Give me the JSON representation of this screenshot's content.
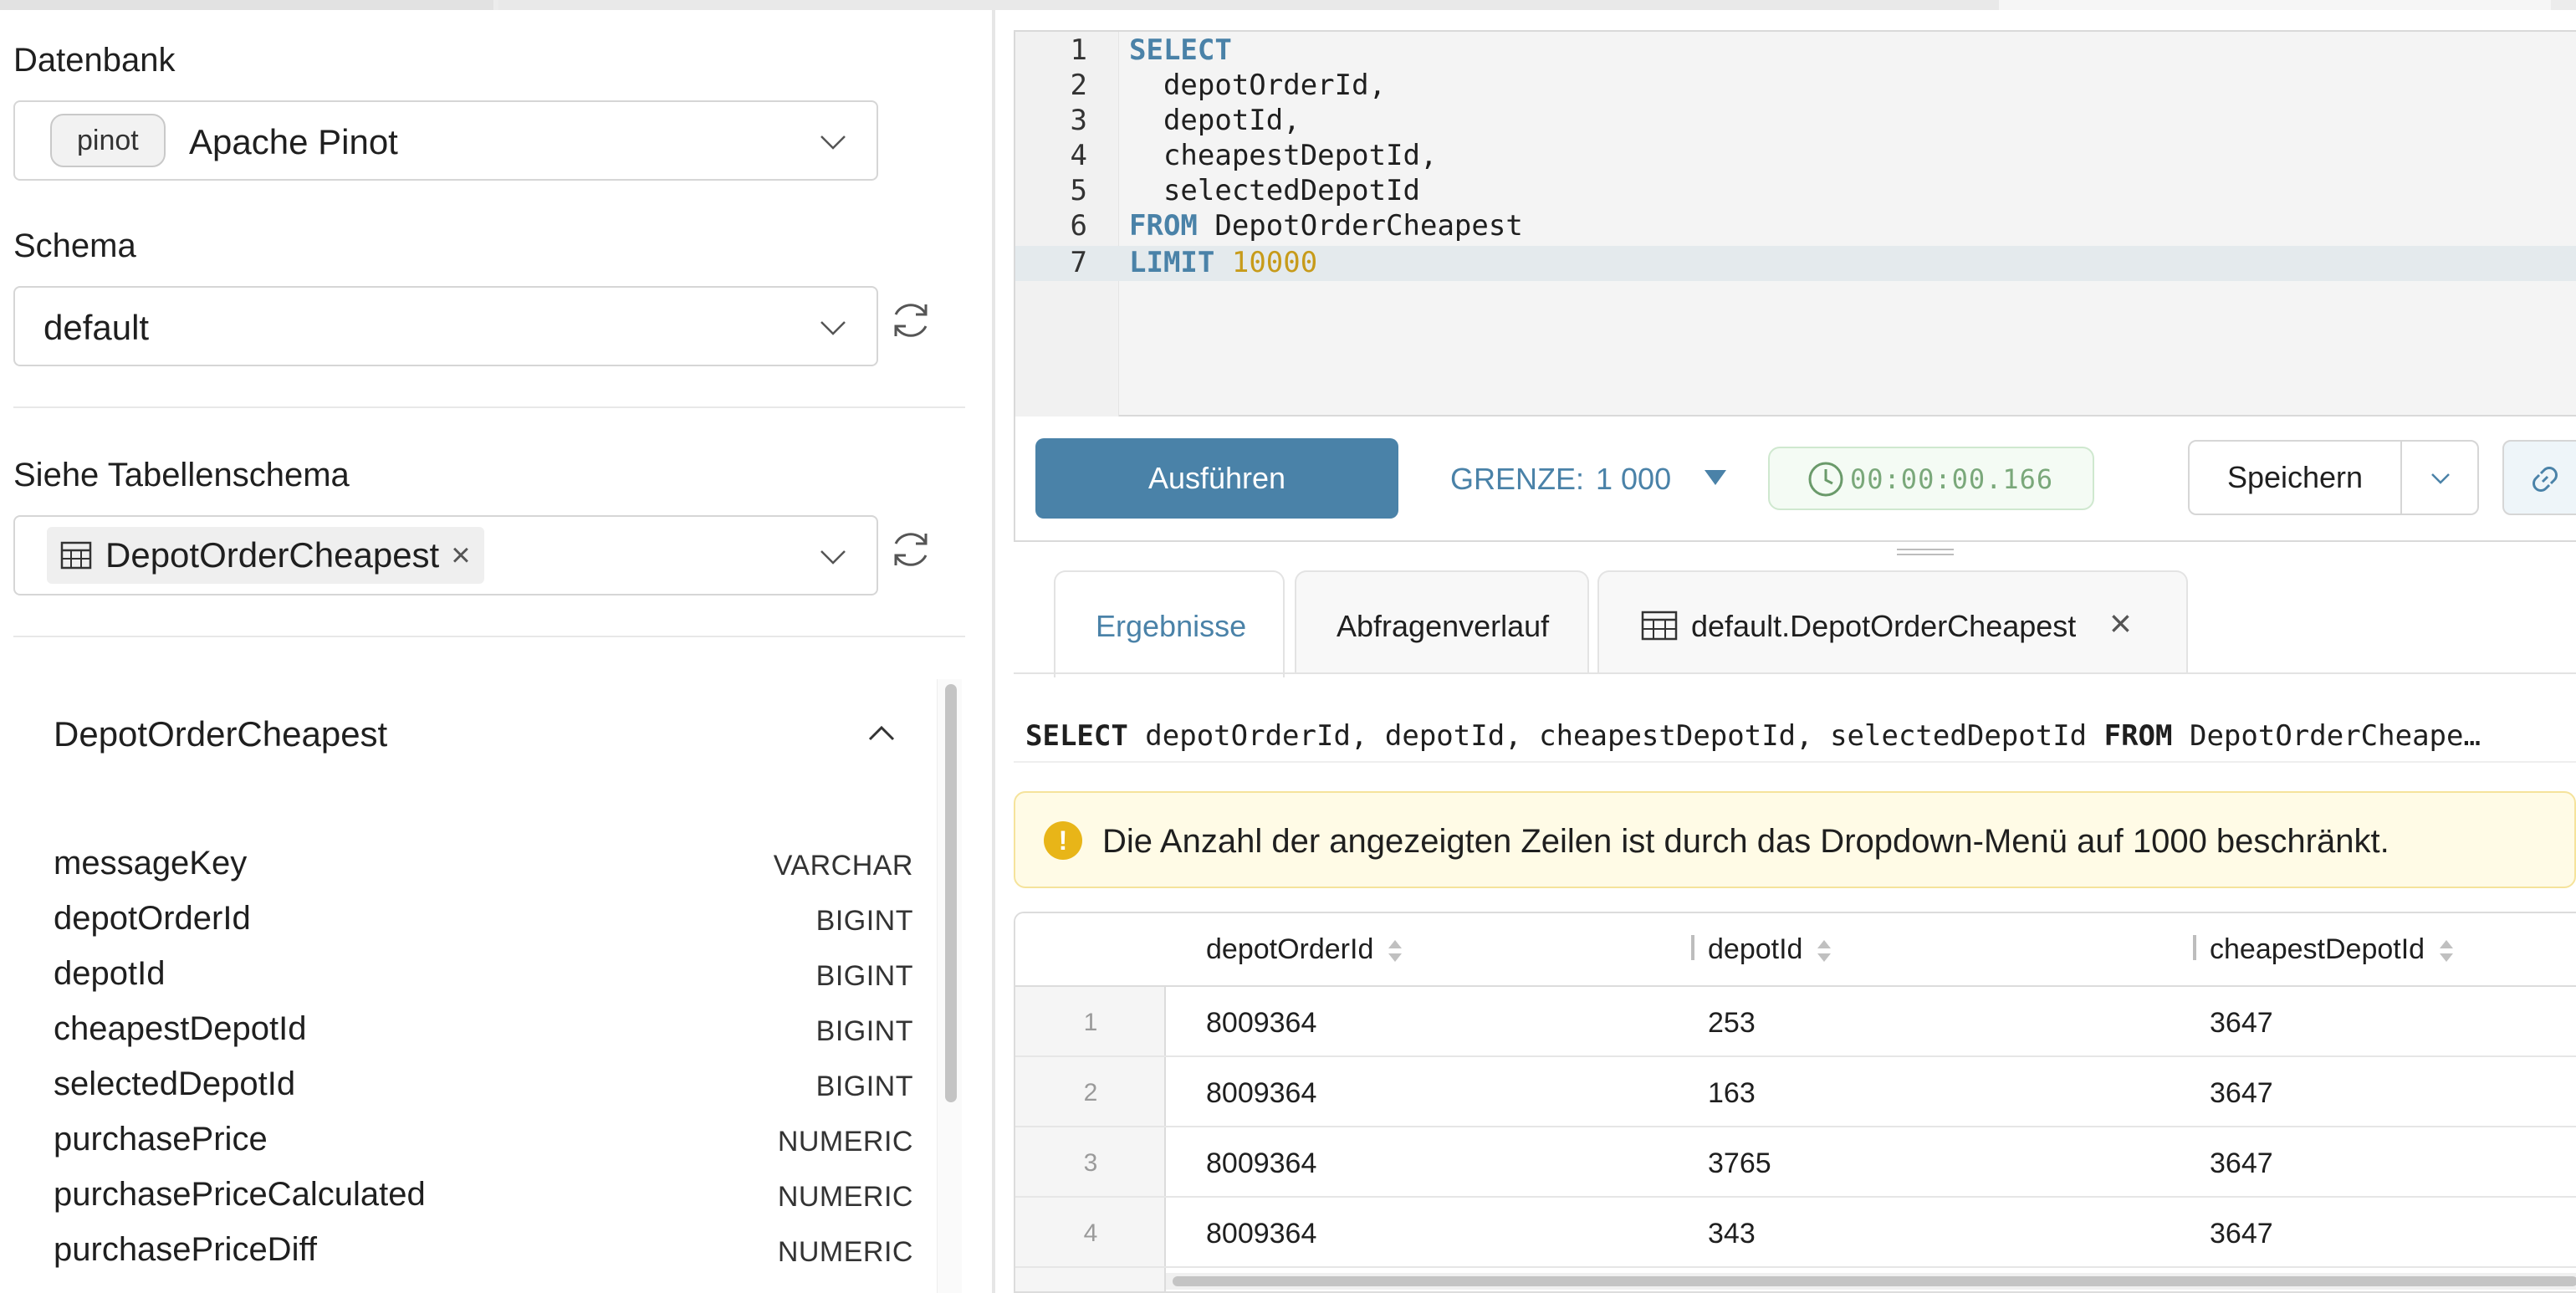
{
  "left": {
    "database": {
      "label": "Datenbank",
      "tag": "pinot",
      "value": "Apache Pinot"
    },
    "schema": {
      "label": "Schema",
      "value": "default"
    },
    "table_schema": {
      "label": "Siehe Tabellenschema",
      "chip": "DepotOrderCheapest"
    },
    "schema_card": {
      "title": "DepotOrderCheapest",
      "columns": [
        {
          "name": "messageKey",
          "type": "VARCHAR"
        },
        {
          "name": "depotOrderId",
          "type": "BIGINT"
        },
        {
          "name": "depotId",
          "type": "BIGINT"
        },
        {
          "name": "cheapestDepotId",
          "type": "BIGINT"
        },
        {
          "name": "selectedDepotId",
          "type": "BIGINT"
        },
        {
          "name": "purchasePrice",
          "type": "NUMERIC"
        },
        {
          "name": "purchasePriceCalculated",
          "type": "NUMERIC"
        },
        {
          "name": "purchasePriceDiff",
          "type": "NUMERIC"
        }
      ]
    }
  },
  "editor": {
    "line_numbers": [
      "1",
      "2",
      "3",
      "4",
      "5",
      "6",
      "7"
    ],
    "lines": [
      {
        "kw": "SELECT",
        "text": "",
        "num": ""
      },
      {
        "kw": "",
        "text": "  depotOrderId,",
        "num": ""
      },
      {
        "kw": "",
        "text": "  depotId,",
        "num": ""
      },
      {
        "kw": "",
        "text": "  cheapestDepotId,",
        "num": ""
      },
      {
        "kw": "",
        "text": "  selectedDepotId",
        "num": ""
      },
      {
        "kw": "FROM",
        "text": " DepotOrderCheapest",
        "num": ""
      },
      {
        "kw": "LIMIT",
        "text": " ",
        "num": "10000"
      }
    ]
  },
  "toolbar": {
    "run_label": "Ausführen",
    "limit_label": "GRENZE:",
    "limit_value": "1 000",
    "timer": "00:00:00.166",
    "save_label": "Speichern"
  },
  "tabs": [
    {
      "label": "Ergebnisse"
    },
    {
      "label": "Abfragenverlauf"
    },
    {
      "label": "default.DepotOrderCheapest"
    }
  ],
  "results": {
    "sql_preview": {
      "kw1": "SELECT",
      "cols": " depotOrderId, depotId, cheapestDepotId, selectedDepotId ",
      "kw2": "FROM",
      "rest": " DepotOrderCheape…"
    },
    "alert": "Die Anzahl der angezeigten Zeilen ist durch das Dropdown-Menü auf 1000 beschränkt.",
    "table": {
      "headers": [
        "depotOrderId",
        "depotId",
        "cheapestDepotId"
      ],
      "rows": [
        {
          "n": "1",
          "cells": [
            "8009364",
            "253",
            "3647"
          ]
        },
        {
          "n": "2",
          "cells": [
            "8009364",
            "163",
            "3647"
          ]
        },
        {
          "n": "3",
          "cells": [
            "8009364",
            "3765",
            "3647"
          ]
        },
        {
          "n": "4",
          "cells": [
            "8009364",
            "343",
            "3647"
          ]
        }
      ]
    }
  },
  "colors": {
    "accent": "#4a82a8",
    "keyword": "#4a82a8",
    "number": "#c79b1a",
    "warning": "#e8b518",
    "timer": "#7aa87a"
  }
}
